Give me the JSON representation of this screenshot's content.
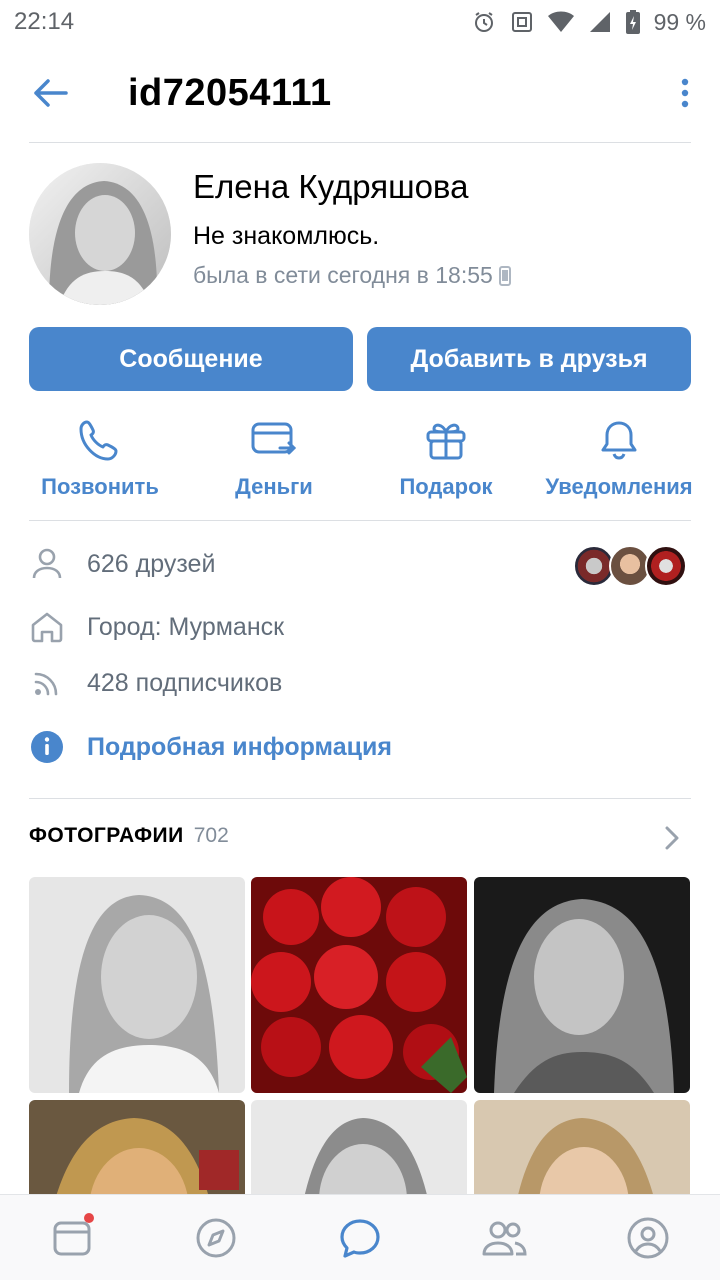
{
  "status_bar": {
    "time": "22:14",
    "battery": "99 %",
    "icons": [
      "alarm-icon",
      "nfc-icon",
      "wifi-icon",
      "signal-icon",
      "battery-icon"
    ]
  },
  "header": {
    "title": "id72054111",
    "back_icon": "arrow-left-icon",
    "more_icon": "more-vertical-icon"
  },
  "profile": {
    "name": "Елена Кудряшова",
    "status": "Не знакомлюсь.",
    "online": "была в сети сегодня в 18:55",
    "online_device_icon": "phone-icon"
  },
  "buttons": {
    "message": "Сообщение",
    "add_friend": "Добавить в друзья"
  },
  "actions": [
    {
      "label": "Позвонить",
      "icon": "phone-call-icon"
    },
    {
      "label": "Деньги",
      "icon": "money-transfer-icon"
    },
    {
      "label": "Подарок",
      "icon": "gift-icon"
    },
    {
      "label": "Уведомления",
      "icon": "bell-icon"
    }
  ],
  "info": {
    "friends": "626 друзей",
    "city": "Город: Мурманск",
    "followers": "428 подписчиков",
    "details": "Подробная информация"
  },
  "photos": {
    "title": "ФОТОГРАФИИ",
    "count": "702"
  },
  "bottom_nav": [
    "news-icon",
    "explore-icon",
    "messages-icon",
    "friends-icon",
    "profile-icon"
  ],
  "colors": {
    "accent": "#4986cc",
    "secondary_text": "#818c99",
    "notification_dot": "#e64646"
  }
}
